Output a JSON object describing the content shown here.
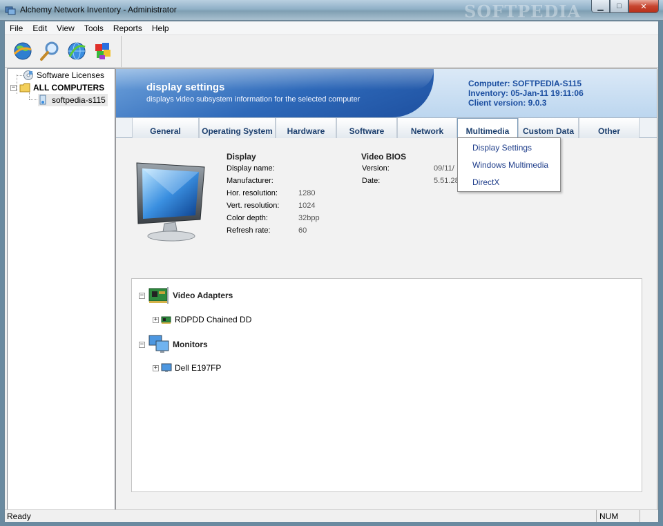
{
  "window": {
    "title": "Alchemy Network Inventory - Administrator",
    "watermark": "SOFTPEDIA",
    "minimize": "▁",
    "maximize": "□",
    "close": "✕"
  },
  "menu": [
    "File",
    "Edit",
    "View",
    "Tools",
    "Reports",
    "Help"
  ],
  "toolbar": {
    "buttons": [
      "refresh-globe-icon",
      "search-icon",
      "network-globe-icon",
      "color-blocks-icon"
    ]
  },
  "tree": {
    "items": [
      {
        "label": "Software Licenses",
        "icon": "license-disc-icon"
      },
      {
        "label": "ALL COMPUTERS",
        "icon": "folder-icon"
      },
      {
        "label": "softpedia-s115",
        "icon": "computer-icon"
      }
    ]
  },
  "banner": {
    "title": "display settings",
    "subtitle": "displays video subsystem information for the selected computer",
    "computer": "Computer: SOFTPEDIA-S115",
    "inventory": "Inventory: 05-Jan-11 19:11:06",
    "client_version": "Client version: 9.0.3"
  },
  "tabs": [
    "General",
    "Operating System",
    "Hardware",
    "Software",
    "Network",
    "Multimedia",
    "Custom Data",
    "Other"
  ],
  "active_tab": "Multimedia",
  "dropdown": [
    "Display Settings",
    "Windows Multimedia",
    "DirectX"
  ],
  "display": {
    "heading": "Display",
    "rows": [
      {
        "label": "Display name:",
        "value": ""
      },
      {
        "label": "Manufacturer:",
        "value": ""
      },
      {
        "label": "Hor. resolution:",
        "value": "1280"
      },
      {
        "label": "Vert. resolution:",
        "value": "1024"
      },
      {
        "label": "Color depth:",
        "value": "32bpp"
      },
      {
        "label": "Refresh rate:",
        "value": "60"
      }
    ]
  },
  "video_bios": {
    "heading": "Video BIOS",
    "rows": [
      {
        "label": "Version:",
        "value": "09/11/"
      },
      {
        "label": "Date:",
        "value": "5.51.28"
      }
    ]
  },
  "hardware_tree": {
    "groups": [
      {
        "label": "Video Adapters",
        "toggle": "−",
        "children": [
          {
            "label": "RDPDD Chained DD",
            "toggle": "+"
          }
        ]
      },
      {
        "label": "Monitors",
        "toggle": "−",
        "children": [
          {
            "label": "Dell E197FP",
            "toggle": "+"
          }
        ]
      }
    ]
  },
  "status": {
    "text": "Ready",
    "num": "NUM"
  }
}
